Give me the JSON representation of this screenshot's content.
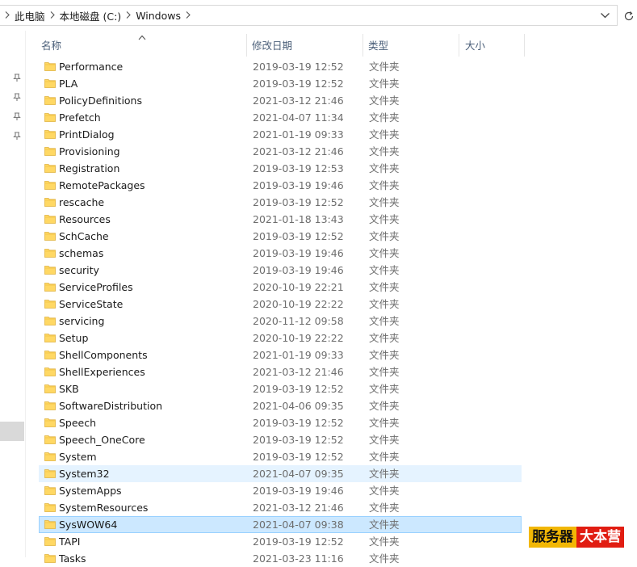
{
  "breadcrumb": {
    "items": [
      "此电脑",
      "本地磁盘 (C:)",
      "Windows"
    ]
  },
  "columns": {
    "name": "名称",
    "modified": "修改日期",
    "type": "类型",
    "size": "大小"
  },
  "files": [
    {
      "name": "Performance",
      "modified": "2019-03-19 12:52",
      "type": "文件夹"
    },
    {
      "name": "PLA",
      "modified": "2019-03-19 12:52",
      "type": "文件夹"
    },
    {
      "name": "PolicyDefinitions",
      "modified": "2021-03-12 21:46",
      "type": "文件夹"
    },
    {
      "name": "Prefetch",
      "modified": "2021-04-07 11:34",
      "type": "文件夹"
    },
    {
      "name": "PrintDialog",
      "modified": "2021-01-19 09:33",
      "type": "文件夹"
    },
    {
      "name": "Provisioning",
      "modified": "2021-03-12 21:46",
      "type": "文件夹"
    },
    {
      "name": "Registration",
      "modified": "2019-03-19 12:53",
      "type": "文件夹"
    },
    {
      "name": "RemotePackages",
      "modified": "2019-03-19 19:46",
      "type": "文件夹"
    },
    {
      "name": "rescache",
      "modified": "2019-03-19 12:52",
      "type": "文件夹"
    },
    {
      "name": "Resources",
      "modified": "2021-01-18 13:43",
      "type": "文件夹"
    },
    {
      "name": "SchCache",
      "modified": "2019-03-19 12:52",
      "type": "文件夹"
    },
    {
      "name": "schemas",
      "modified": "2019-03-19 19:46",
      "type": "文件夹"
    },
    {
      "name": "security",
      "modified": "2019-03-19 19:46",
      "type": "文件夹"
    },
    {
      "name": "ServiceProfiles",
      "modified": "2020-10-19 22:21",
      "type": "文件夹"
    },
    {
      "name": "ServiceState",
      "modified": "2020-10-19 22:22",
      "type": "文件夹"
    },
    {
      "name": "servicing",
      "modified": "2020-11-12 09:58",
      "type": "文件夹"
    },
    {
      "name": "Setup",
      "modified": "2020-10-19 22:22",
      "type": "文件夹"
    },
    {
      "name": "ShellComponents",
      "modified": "2021-01-19 09:33",
      "type": "文件夹"
    },
    {
      "name": "ShellExperiences",
      "modified": "2021-03-12 21:46",
      "type": "文件夹"
    },
    {
      "name": "SKB",
      "modified": "2019-03-19 12:52",
      "type": "文件夹"
    },
    {
      "name": "SoftwareDistribution",
      "modified": "2021-04-06 09:35",
      "type": "文件夹"
    },
    {
      "name": "Speech",
      "modified": "2019-03-19 12:52",
      "type": "文件夹"
    },
    {
      "name": "Speech_OneCore",
      "modified": "2019-03-19 12:52",
      "type": "文件夹"
    },
    {
      "name": "System",
      "modified": "2019-03-19 12:52",
      "type": "文件夹"
    },
    {
      "name": "System32",
      "modified": "2021-04-07 09:35",
      "type": "文件夹",
      "state": "hover"
    },
    {
      "name": "SystemApps",
      "modified": "2019-03-19 19:46",
      "type": "文件夹"
    },
    {
      "name": "SystemResources",
      "modified": "2021-03-12 21:46",
      "type": "文件夹"
    },
    {
      "name": "SysWOW64",
      "modified": "2021-04-07 09:38",
      "type": "文件夹",
      "state": "selected"
    },
    {
      "name": "TAPI",
      "modified": "2019-03-19 12:52",
      "type": "文件夹"
    },
    {
      "name": "Tasks",
      "modified": "2021-03-23 11:16",
      "type": "文件夹"
    }
  ],
  "watermark": {
    "part1": "服务器",
    "part2": "大本营"
  },
  "colors": {
    "selected_bg": "#cce8ff",
    "selected_border": "#99d1ff",
    "hover_bg": "#e5f3ff",
    "header_text": "#4c607a",
    "secondary_text": "#6d6d6d",
    "folder_yellow": "#ffd864"
  },
  "icons": {
    "folder": "folder-icon",
    "pin": "pin-icon",
    "chevron": "chevron-right-icon",
    "dropdown": "chevron-down-icon",
    "refresh": "refresh-icon",
    "sort": "sort-ascending-icon"
  }
}
